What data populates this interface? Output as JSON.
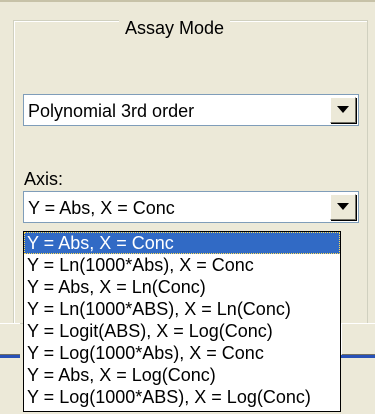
{
  "group_box": {
    "title": "Assay Mode"
  },
  "assay_combo": {
    "selected": "Polynomial 3rd order"
  },
  "axis": {
    "label": "Axis:",
    "selected": "Y = Abs, X = Conc",
    "options": [
      "Y = Abs, X = Conc",
      "Y = Ln(1000*Abs), X = Conc",
      "Y = Abs, X = Ln(Conc)",
      "Y = Ln(1000*ABS), X = Ln(Conc)",
      "Y = Logit(ABS), X = Log(Conc)",
      "Y = Log(1000*Abs), X = Conc",
      "Y = Abs, X = Log(Conc)",
      "Y = Log(1000*ABS), X = Log(Conc)"
    ],
    "highlighted_index": 0
  },
  "colors": {
    "highlight": "#316ac5",
    "dialog_bg": "#ece9d8",
    "accent_line": "#2851b7"
  },
  "icons": {
    "dropdown": "chevron-down-icon"
  }
}
